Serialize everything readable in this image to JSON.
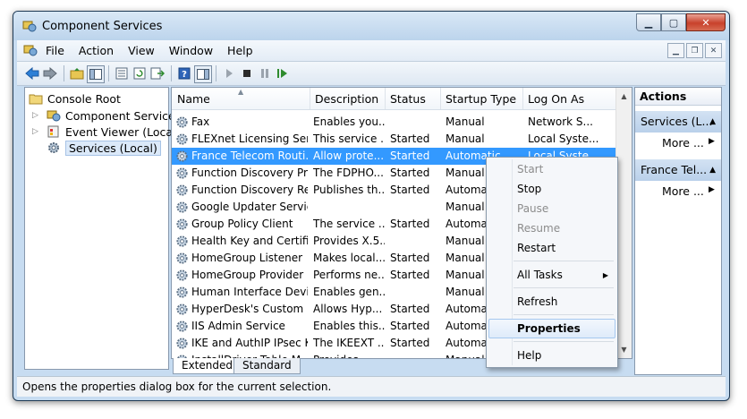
{
  "window": {
    "title": "Component Services"
  },
  "menu": {
    "items": [
      "File",
      "Action",
      "View",
      "Window",
      "Help"
    ]
  },
  "tree": {
    "items": [
      {
        "label": "Console Root"
      },
      {
        "label": "Component Services"
      },
      {
        "label": "Event Viewer (Local)"
      },
      {
        "label": "Services (Local)"
      }
    ]
  },
  "list": {
    "columns": [
      "Name",
      "Description",
      "Status",
      "Startup Type",
      "Log On As"
    ],
    "rows": [
      {
        "name": "Fax",
        "description": "Enables you...",
        "status": "",
        "startup": "Manual",
        "logon": "Network S..."
      },
      {
        "name": "FLEXnet Licensing Ser...",
        "description": "This service ...",
        "status": "Started",
        "startup": "Manual",
        "logon": "Local Syste..."
      },
      {
        "name": "France Telecom Routi...",
        "description": "Allow prote...",
        "status": "Started",
        "startup": "Automatic",
        "logon": "Local Syste..."
      },
      {
        "name": "Function Discovery Pr...",
        "description": "The FDPHO...",
        "status": "Started",
        "startup": "Manual",
        "logon": ""
      },
      {
        "name": "Function Discovery Re...",
        "description": "Publishes th...",
        "status": "Started",
        "startup": "Automat",
        "logon": ""
      },
      {
        "name": "Google Updater Service",
        "description": "",
        "status": "",
        "startup": "Manual",
        "logon": ""
      },
      {
        "name": "Group Policy Client",
        "description": "The service ...",
        "status": "Started",
        "startup": "Automat",
        "logon": ""
      },
      {
        "name": "Health Key and Certifi...",
        "description": "Provides X.5...",
        "status": "",
        "startup": "Manual",
        "logon": ""
      },
      {
        "name": "HomeGroup Listener",
        "description": "Makes local...",
        "status": "Started",
        "startup": "Manual",
        "logon": ""
      },
      {
        "name": "HomeGroup Provider",
        "description": "Performs ne...",
        "status": "Started",
        "startup": "Manual",
        "logon": ""
      },
      {
        "name": "Human Interface Devi...",
        "description": "Enables gen...",
        "status": "",
        "startup": "Manual",
        "logon": ""
      },
      {
        "name": "HyperDesk's Custom ...",
        "description": "Allows Hyp...",
        "status": "Started",
        "startup": "Automat",
        "logon": ""
      },
      {
        "name": "IIS Admin Service",
        "description": "Enables this...",
        "status": "Started",
        "startup": "Automat",
        "logon": ""
      },
      {
        "name": "IKE and AuthIP IPsec K...",
        "description": "The IKEEXT ...",
        "status": "Started",
        "startup": "Automat",
        "logon": ""
      },
      {
        "name": "InstallDriver Table M...",
        "description": "Provides...",
        "status": "",
        "startup": "Manual",
        "logon": ""
      }
    ]
  },
  "tabs": [
    "Extended",
    "Standard"
  ],
  "actions": {
    "title": "Actions",
    "groups": [
      {
        "label": "Services (L...",
        "more": "More ..."
      },
      {
        "label": "France Tel...",
        "more": "More ..."
      }
    ]
  },
  "context_menu": {
    "items": [
      {
        "label": "Start",
        "disabled": true
      },
      {
        "label": "Stop",
        "disabled": false
      },
      {
        "label": "Pause",
        "disabled": true
      },
      {
        "label": "Resume",
        "disabled": true
      },
      {
        "label": "Restart",
        "disabled": false
      },
      {
        "label": "All Tasks",
        "disabled": false
      },
      {
        "label": "Refresh",
        "disabled": false
      },
      {
        "label": "Properties",
        "disabled": false
      },
      {
        "label": "Help",
        "disabled": false
      }
    ]
  },
  "status": {
    "text": "Opens the properties dialog box for the current selection."
  },
  "colors": {
    "selection": "#3399ff",
    "title_bar": "#c7dcf1",
    "close_button": "#c8412b"
  }
}
